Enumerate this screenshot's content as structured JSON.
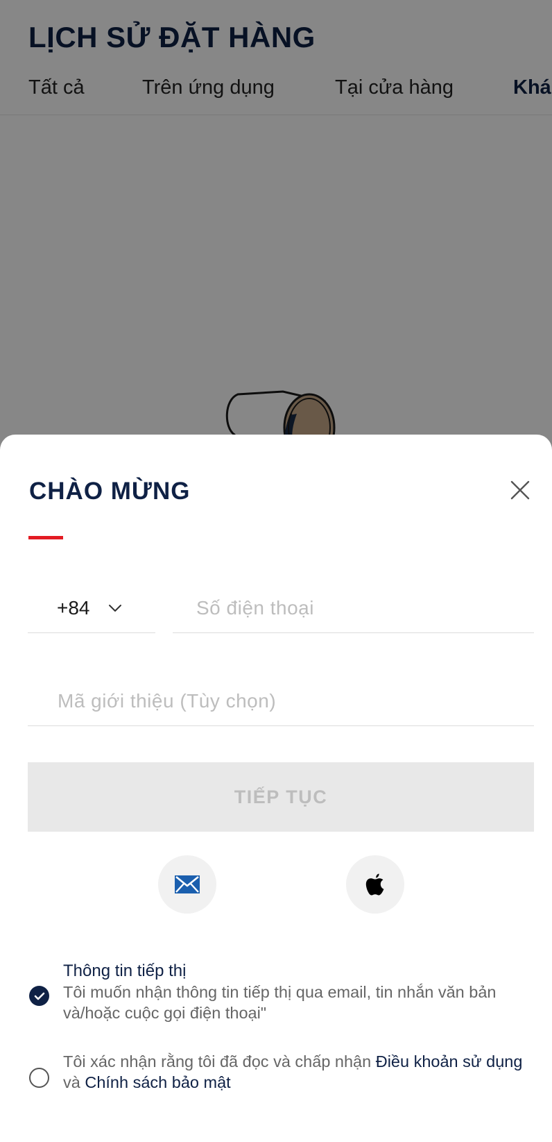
{
  "background": {
    "title": "LỊCH SỬ ĐẶT HÀNG",
    "tabs": [
      {
        "label": "Tất cả"
      },
      {
        "label": "Trên ứng dụng"
      },
      {
        "label": "Tại cửa hàng"
      },
      {
        "label": "Khá"
      }
    ]
  },
  "sheet": {
    "title": "CHÀO MỪNG",
    "accent_color": "#e31b23",
    "country_code": "+84",
    "phone_placeholder": "Số điện thoại",
    "referral_placeholder": "Mã giới thiệu (Tùy chọn)",
    "continue_label": "TIẾP TỤC",
    "social": [
      {
        "icon": "envelope-icon"
      },
      {
        "icon": "apple-icon"
      }
    ],
    "marketing": {
      "checked": true,
      "title": "Thông tin tiếp thị",
      "body": "Tôi muốn nhận thông tin tiếp thị qua email, tin nhắn văn bản và/hoặc cuộc gọi điện thoại\""
    },
    "terms": {
      "checked": false,
      "prefix": "Tôi xác nhận rằng tôi đã đọc và chấp nhận ",
      "terms_link": "Điều khoản sử dụng",
      "connector": " và ",
      "privacy_link": "Chính sách bảo mật"
    }
  }
}
